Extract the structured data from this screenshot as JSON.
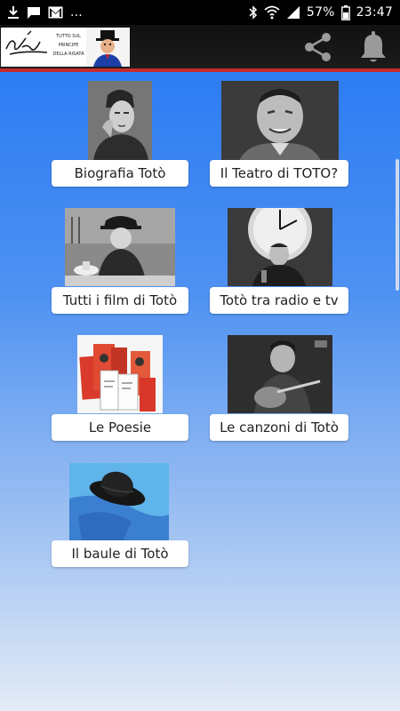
{
  "status_bar": {
    "icons_left": [
      "download-icon",
      "chat-icon",
      "gmail-icon"
    ],
    "overflow": "...",
    "battery_percent": "57%",
    "time": "23:47",
    "icons_right": [
      "bluetooth-icon",
      "wifi-icon",
      "signal-icon",
      "battery-icon"
    ]
  },
  "app_bar": {
    "logo_lines": [
      "TUTTO SUL",
      "PRINCIPE",
      "DELLA RISATA"
    ],
    "actions": [
      "share-icon",
      "bell-icon"
    ],
    "accent_color": "#c62b2b",
    "background_color": "#151515"
  },
  "tiles": [
    {
      "label": "Biografia Totò"
    },
    {
      "label": "Il Teatro di TOTO?"
    },
    {
      "label": "Tutti i film di Totò"
    },
    {
      "label": "Totò tra radio e tv"
    },
    {
      "label": "Le Poesie"
    },
    {
      "label": "Le canzoni di Totò"
    },
    {
      "label": "Il baule di Totò"
    }
  ],
  "colors": {
    "content_top": "#2c7cf3",
    "content_bottom": "#e4ecf6",
    "label_background": "#ffffff"
  }
}
